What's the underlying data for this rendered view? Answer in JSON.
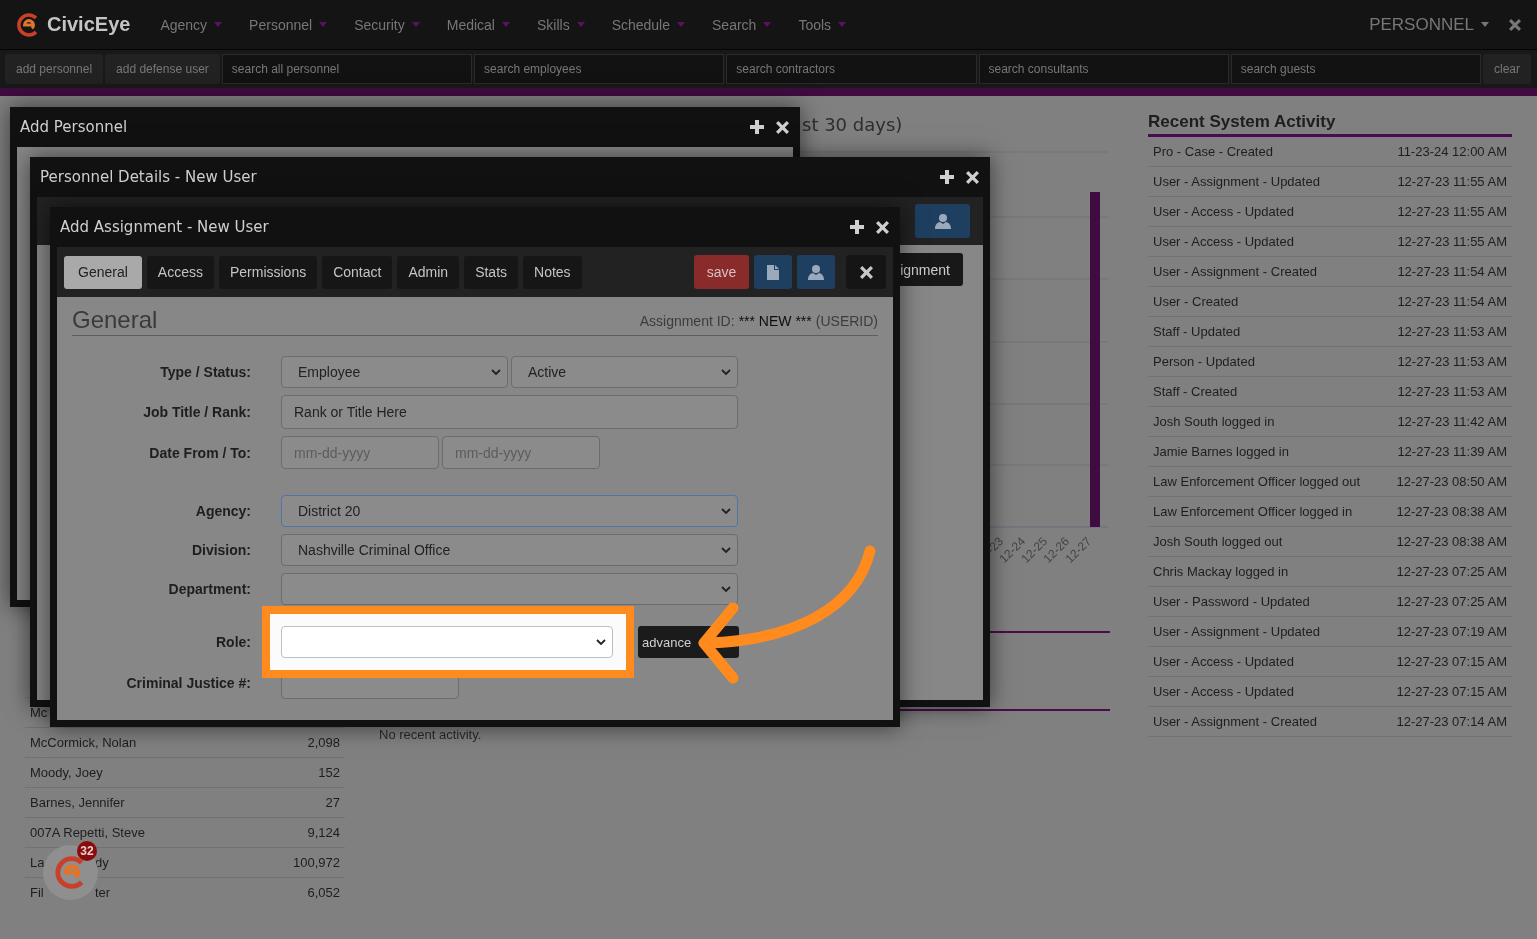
{
  "brand": "CivicEye",
  "nav_menus": [
    {
      "label": "Agency"
    },
    {
      "label": "Personnel"
    },
    {
      "label": "Security"
    },
    {
      "label": "Medical"
    },
    {
      "label": "Skills"
    },
    {
      "label": "Schedule"
    },
    {
      "label": "Search"
    },
    {
      "label": "Tools"
    }
  ],
  "module_menu": "PERSONNEL",
  "quick_bar": {
    "buttons": [
      "add personnel",
      "add defense user"
    ],
    "searches": [
      {
        "placeholder": "search all personnel"
      },
      {
        "placeholder": "search employees"
      },
      {
        "placeholder": "search contractors"
      },
      {
        "placeholder": "search consultants"
      },
      {
        "placeholder": "search guests"
      }
    ],
    "clear": "clear"
  },
  "roster": [
    {
      "name": "Mc"
    },
    {
      "name": "McCormick, Nolan",
      "count": "2,098"
    },
    {
      "name": "Moody, Joey",
      "count": "152"
    },
    {
      "name": "Barnes, Jennifer",
      "count": "27"
    },
    {
      "name": "007A Repetti, Steve",
      "count": "9,124"
    },
    {
      "name": "La",
      "name_end": "dy",
      "count": "100,972"
    },
    {
      "name": "Fil",
      "name_end": "ter",
      "count": "6,052"
    }
  ],
  "chart": {
    "title": "st 30 days)",
    "x_labels": [
      "-23",
      "12-24",
      "12-25",
      "12-26",
      "12-27"
    ]
  },
  "activity_message": "No recent activity.",
  "recent_activity": {
    "title": "Recent System Activity",
    "rows": [
      {
        "event": "Pro - Case - Created",
        "time": "11-23-24 12:00 AM"
      },
      {
        "event": "User - Assignment - Updated",
        "time": "12-27-23 11:55 AM"
      },
      {
        "event": "User - Access - Updated",
        "time": "12-27-23 11:55 AM"
      },
      {
        "event": "User - Access - Updated",
        "time": "12-27-23 11:55 AM"
      },
      {
        "event": "User - Assignment - Created",
        "time": "12-27-23 11:54 AM"
      },
      {
        "event": "User - Created",
        "time": "12-27-23 11:54 AM"
      },
      {
        "event": "Staff - Updated",
        "time": "12-27-23 11:53 AM"
      },
      {
        "event": "Person - Updated",
        "time": "12-27-23 11:53 AM"
      },
      {
        "event": "Staff - Created",
        "time": "12-27-23 11:53 AM"
      },
      {
        "event": "Josh South logged in",
        "time": "12-27-23 11:42 AM"
      },
      {
        "event": "Jamie Barnes logged in",
        "time": "12-27-23 11:39 AM"
      },
      {
        "event": "Law Enforcement Officer logged out",
        "time": "12-27-23 08:50 AM"
      },
      {
        "event": "Law Enforcement Officer logged in",
        "time": "12-27-23 08:38 AM"
      },
      {
        "event": "Josh South logged out",
        "time": "12-27-23 08:38 AM"
      },
      {
        "event": "Chris Mackay logged in",
        "time": "12-27-23 07:25 AM"
      },
      {
        "event": "User - Password - Updated",
        "time": "12-27-23 07:25 AM"
      },
      {
        "event": "User - Assignment - Updated",
        "time": "12-27-23 07:19 AM"
      },
      {
        "event": "User - Access - Updated",
        "time": "12-27-23 07:15 AM"
      },
      {
        "event": "User - Access - Updated",
        "time": "12-27-23 07:15 AM"
      },
      {
        "event": "User - Assignment - Created",
        "time": "12-27-23 07:14 AM"
      }
    ]
  },
  "windows": [
    {
      "title": "Add Personnel"
    },
    {
      "title": "Personnel Details - New User",
      "action": "ignment"
    },
    {
      "title": "Add Assignment - New User"
    }
  ],
  "assignment": {
    "tabs": [
      {
        "label": "General",
        "selected": true
      },
      {
        "label": "Access",
        "selected": false
      },
      {
        "label": "Permissions",
        "selected": false
      },
      {
        "label": "Contact",
        "selected": false
      },
      {
        "label": "Admin",
        "selected": false
      },
      {
        "label": "Stats",
        "selected": false
      },
      {
        "label": "Notes",
        "selected": false
      }
    ],
    "actions": [
      {
        "kind": "save",
        "label": "save"
      },
      {
        "kind": "file"
      },
      {
        "kind": "user"
      },
      {
        "kind": "close"
      }
    ],
    "section": {
      "heading": "General",
      "id_label": "Assignment ID:",
      "id_value": "*** NEW ***",
      "id_suffix": "(USERID)"
    },
    "fields": [
      {
        "label": "Type / Status:",
        "controls": [
          {
            "kind": "select",
            "value": "Employee"
          },
          {
            "kind": "select",
            "value": "Active"
          }
        ]
      },
      {
        "label": "Job Title / Rank:",
        "controls": [
          {
            "kind": "text",
            "value": "Rank or Title Here"
          }
        ]
      },
      {
        "label": "Date From / To:",
        "controls": [
          {
            "kind": "text",
            "placeholder": "mm-dd-yyyy"
          },
          {
            "kind": "text",
            "placeholder": "mm-dd-yyyy"
          }
        ]
      },
      {
        "label": "Agency:",
        "controls": [
          {
            "kind": "select",
            "value": "District 20",
            "focused": true
          }
        ]
      },
      {
        "label": "Division:",
        "controls": [
          {
            "kind": "select",
            "value": "Nashville Criminal Office"
          }
        ]
      },
      {
        "label": "Department:",
        "controls": [
          {
            "kind": "select"
          }
        ]
      },
      {
        "label": "Role:",
        "controls": [
          {
            "kind": "select",
            "highlighted": true
          },
          {
            "kind": "button",
            "label": "advance"
          }
        ]
      },
      {
        "label": "Criminal Justice #:",
        "controls": [
          {
            "kind": "text"
          }
        ]
      }
    ],
    "callout_arrow": true
  },
  "notification_count": "32"
}
